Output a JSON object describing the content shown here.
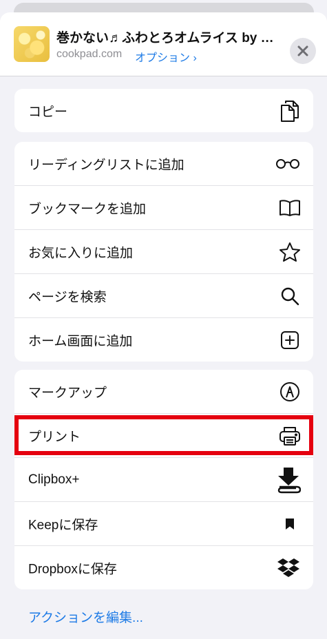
{
  "header": {
    "title": "巻かない♬ふわとろオムライス by ミ…",
    "site": "cookpad.com",
    "options_label": "オプション ›"
  },
  "groups": [
    {
      "items": [
        {
          "label": "コピー",
          "icon": "copy-icon"
        }
      ]
    },
    {
      "items": [
        {
          "label": "リーディングリストに追加",
          "icon": "glasses-icon"
        },
        {
          "label": "ブックマークを追加",
          "icon": "book-icon"
        },
        {
          "label": "お気に入りに追加",
          "icon": "star-icon"
        },
        {
          "label": "ページを検索",
          "icon": "search-icon"
        },
        {
          "label": "ホーム画面に追加",
          "icon": "add-square-icon"
        }
      ]
    },
    {
      "items": [
        {
          "label": "マークアップ",
          "icon": "markup-pen-icon"
        },
        {
          "label": "プリント",
          "icon": "printer-icon",
          "highlighted": true
        },
        {
          "label": "Clipbox+",
          "icon": "clipbox-download-icon"
        },
        {
          "label": "Keepに保存",
          "icon": "bookmark-icon"
        },
        {
          "label": "Dropboxに保存",
          "icon": "dropbox-icon"
        }
      ]
    }
  ],
  "footer": {
    "edit_actions": "アクションを編集..."
  },
  "colors": {
    "accent": "#1e7be6",
    "highlight": "#e5000f",
    "background": "#f2f2f7"
  }
}
